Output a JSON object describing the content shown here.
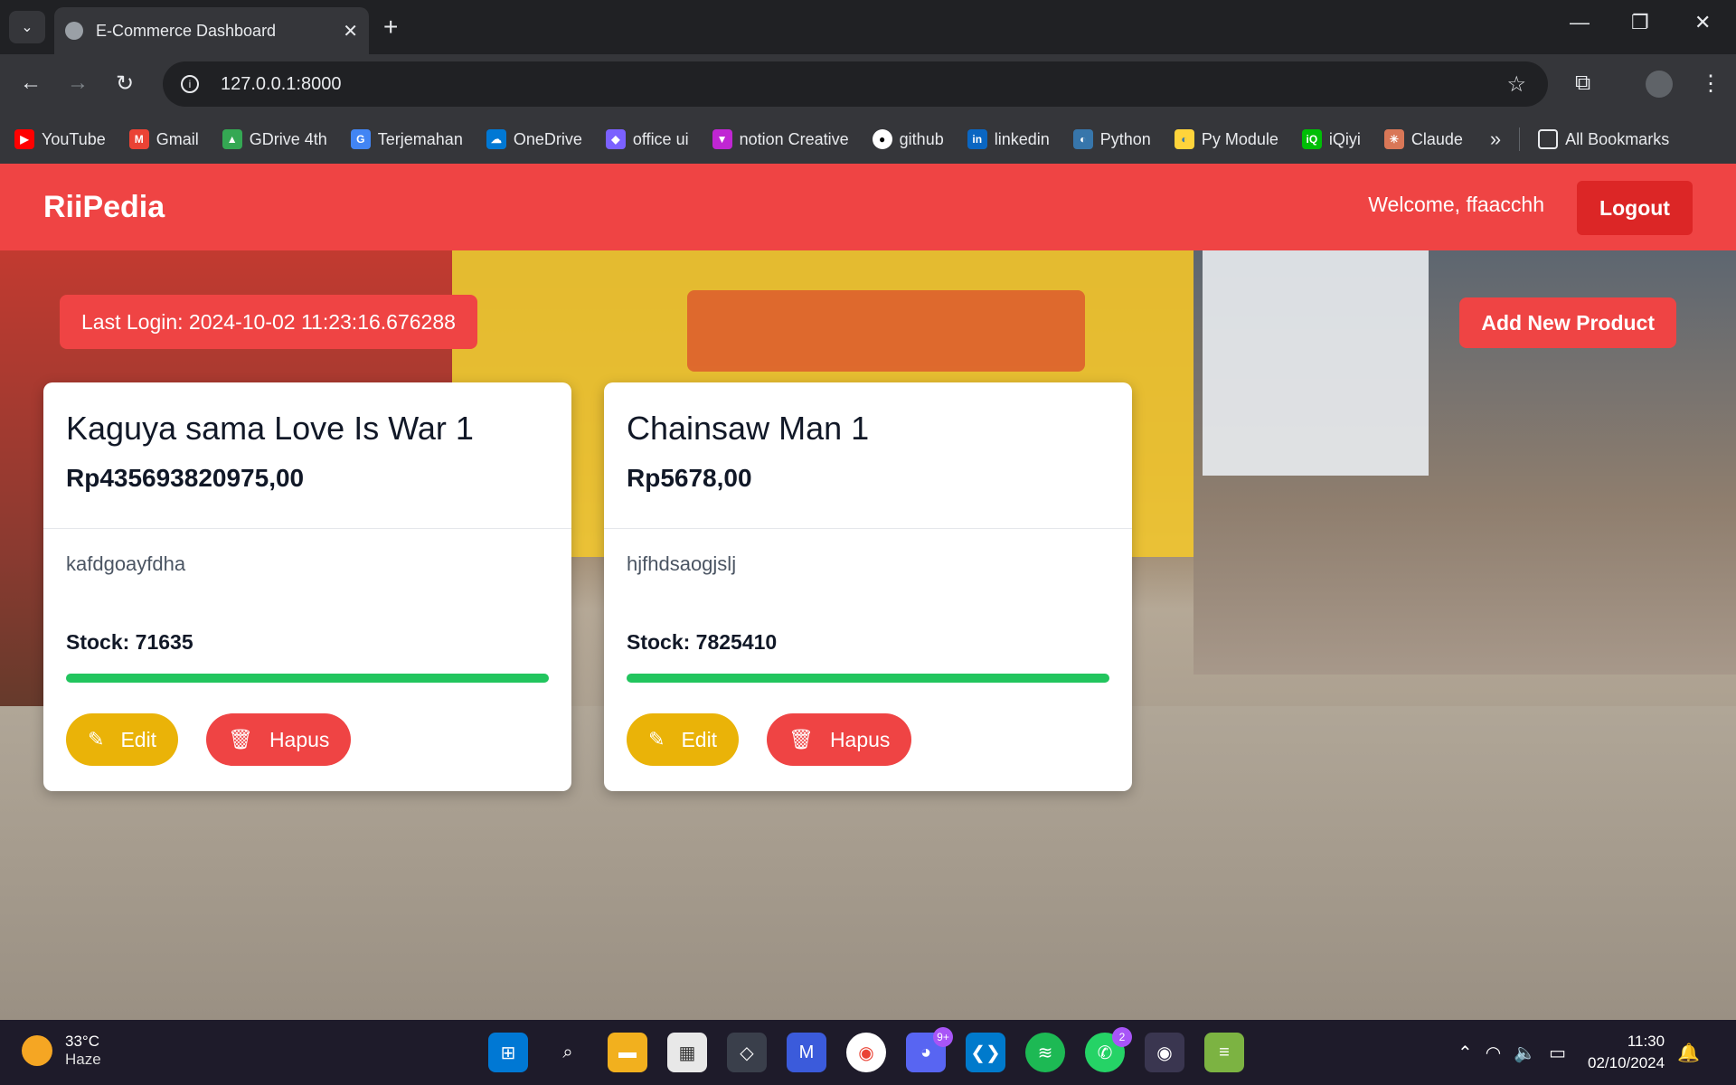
{
  "browser": {
    "tab_title": "E-Commerce Dashboard",
    "url": "127.0.0.1:8000",
    "bookmarks": [
      {
        "label": "YouTube",
        "icon": "youtube-icon",
        "color": "#ff0000"
      },
      {
        "label": "Gmail",
        "icon": "gmail-icon",
        "color": "#ea4335"
      },
      {
        "label": "GDrive 4th",
        "icon": "gdrive-icon",
        "color": "#34a853"
      },
      {
        "label": "Terjemahan",
        "icon": "translate-icon",
        "color": "#4285f4"
      },
      {
        "label": "OneDrive",
        "icon": "onedrive-icon",
        "color": "#0078d4"
      },
      {
        "label": "office ui",
        "icon": "office-icon",
        "color": "#7b61ff"
      },
      {
        "label": "notion Creative",
        "icon": "notion-icon",
        "color": "#c026d3"
      },
      {
        "label": "github",
        "icon": "github-icon",
        "color": "#ffffff"
      },
      {
        "label": "linkedin",
        "icon": "linkedin-icon",
        "color": "#0a66c2"
      },
      {
        "label": "Python",
        "icon": "python-icon",
        "color": "#3776ab"
      },
      {
        "label": "Py Module",
        "icon": "pymodule-icon",
        "color": "#ffd43b"
      },
      {
        "label": "iQiyi",
        "icon": "iqiyi-icon",
        "color": "#00be06"
      },
      {
        "label": "Claude",
        "icon": "claude-icon",
        "color": "#d97757"
      }
    ],
    "all_bookmarks": "All Bookmarks"
  },
  "app": {
    "brand": "RiiPedia",
    "welcome": "Welcome, ffaacchh",
    "logout": "Logout",
    "last_login": "Last Login: 2024-10-02 11:23:16.676288",
    "add_product": "Add New Product",
    "products": [
      {
        "name": "Kaguya sama Love Is War 1",
        "price": "Rp435693820975,00",
        "description": "kafdgoayfdha",
        "stock": "Stock: 71635",
        "stock_fill": 1.0,
        "edit": "Edit",
        "delete": "Hapus"
      },
      {
        "name": "Chainsaw Man 1",
        "price": "Rp5678,00",
        "description": "hjfhdsaogjslj",
        "stock": "Stock: 7825410",
        "stock_fill": 1.0,
        "edit": "Edit",
        "delete": "Hapus"
      }
    ]
  },
  "taskbar": {
    "temperature": "33°C",
    "weather": "Haze",
    "time": "11:30",
    "date": "02/10/2024",
    "discord_badge": "9+",
    "whatsapp_badge": "2"
  },
  "colors": {
    "navbar": "#ef4444",
    "edit": "#eab308",
    "delete": "#ef4444",
    "stock_bar": "#22c55e"
  }
}
